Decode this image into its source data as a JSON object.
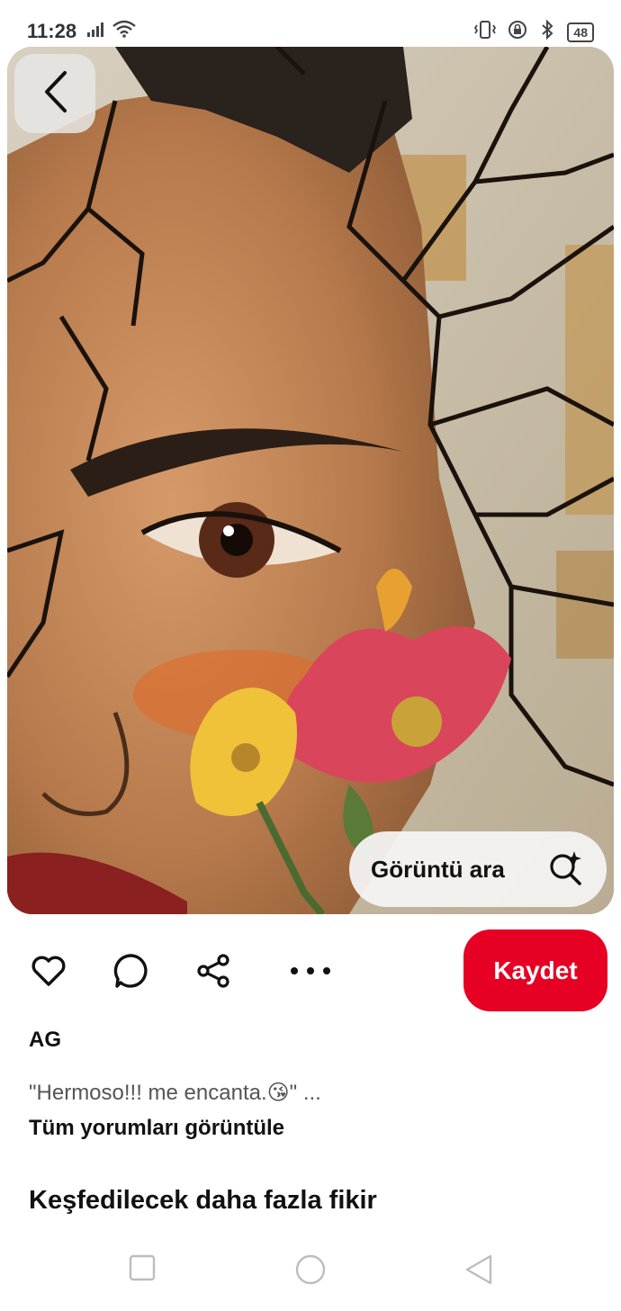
{
  "status_bar": {
    "time": "11:28",
    "battery": "48",
    "icons": [
      "signal-icon",
      "wifi-icon",
      "vibrate-icon",
      "rotation-lock-icon",
      "bluetooth-icon",
      "battery-icon"
    ]
  },
  "image": {
    "description_icon": "artwork-image",
    "visual_search_label": "Görüntü ara"
  },
  "actions": {
    "icons": [
      "heart-icon",
      "comment-icon",
      "share-icon",
      "more-icon"
    ],
    "save_label": "Kaydet"
  },
  "pin": {
    "author": "AG",
    "comment_preview": "\"Hermoso!!! me encanta.😘\" ...",
    "view_all_comments": "Tüm yorumları görüntüle",
    "more_ideas_heading": "Keşfedilecek daha fazla fikir"
  },
  "nav": {
    "icons": [
      "recent-apps-icon",
      "home-icon",
      "back-icon"
    ]
  },
  "colors": {
    "accent": "#e60023",
    "text": "#111111",
    "muted": "#555555"
  }
}
